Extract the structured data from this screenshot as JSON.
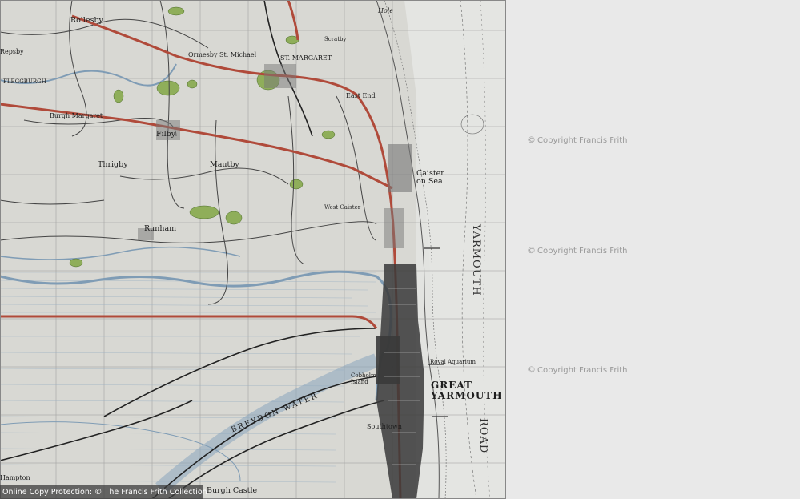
{
  "watermark": {
    "text": "Copyright Francis Frith",
    "symbol": "©"
  },
  "footer": {
    "text": "Online Copy Protection: © The Francis Frith Collection"
  },
  "sea_label": {
    "top": "YARMOUTH",
    "bottom": "ROAD"
  },
  "places": {
    "rollesby": "Rollesby",
    "ormesby": "Ormesby St. Michael",
    "st_margaret": "ST. MARGARET",
    "filby": "Filby",
    "thrigby": "Thrigby",
    "mautby": "Mautby",
    "runham": "Runham",
    "caister_on_sea": "Caister on Sea",
    "west_caister": "West Caister",
    "great_yarmouth_1": "GREAT",
    "great_yarmouth_2": "YARMOUTH",
    "gorleston": "Gorleston",
    "burgh_castle": "Burgh Castle",
    "burgh_margaret": "Burgh Margaret",
    "scratby": "Scratby",
    "east_end": "East End",
    "hole": "Hole",
    "cobholm": "Cobholm Island",
    "southtown": "Southtown",
    "breydon": "BREYDON WATER",
    "jarmouth_aquarium": "Royal Aquarium",
    "stampton": "Hampton",
    "flegburgh": "FLEGGBURGH",
    "repsby": "Repsby"
  },
  "colors": {
    "map_bg": "#d6d7d2",
    "road_a": "#b04a3a",
    "water": "#8aa6bd",
    "woods": "#8fae5a",
    "town": "#3a3a3a"
  }
}
